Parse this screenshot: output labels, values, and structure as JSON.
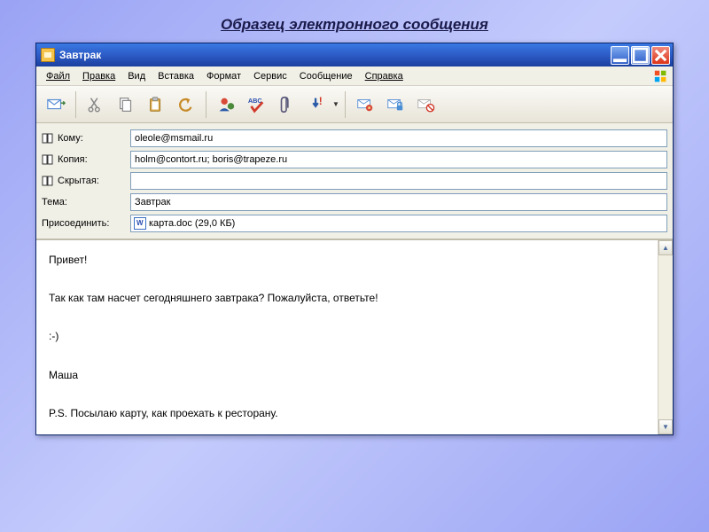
{
  "page": {
    "title": "Образец электронного сообщения"
  },
  "window": {
    "title": "Завтрак"
  },
  "menu": {
    "file": "Файл",
    "edit": "Правка",
    "view": "Вид",
    "insert": "Вставка",
    "format": "Формат",
    "tools": "Сервис",
    "message": "Сообщение",
    "help": "Справка"
  },
  "labels": {
    "to": "Кому:",
    "cc": "Копия:",
    "bcc": "Скрытая:",
    "subject": "Тема:",
    "attach": "Присоединить:"
  },
  "fields": {
    "to": "oleole@msmail.ru",
    "cc": "holm@contort.ru; boris@trapeze.ru",
    "bcc": "",
    "subject": "Завтрак",
    "attachment": "карта.doc (29,0 КБ)"
  },
  "body": "Привет!\n\nТак как там насчет сегодняшнего завтрака? Пожалуйста, ответьте!\n\n:-)\n\nМаша\n\nP.S. Посылаю карту, как проехать к ресторану."
}
